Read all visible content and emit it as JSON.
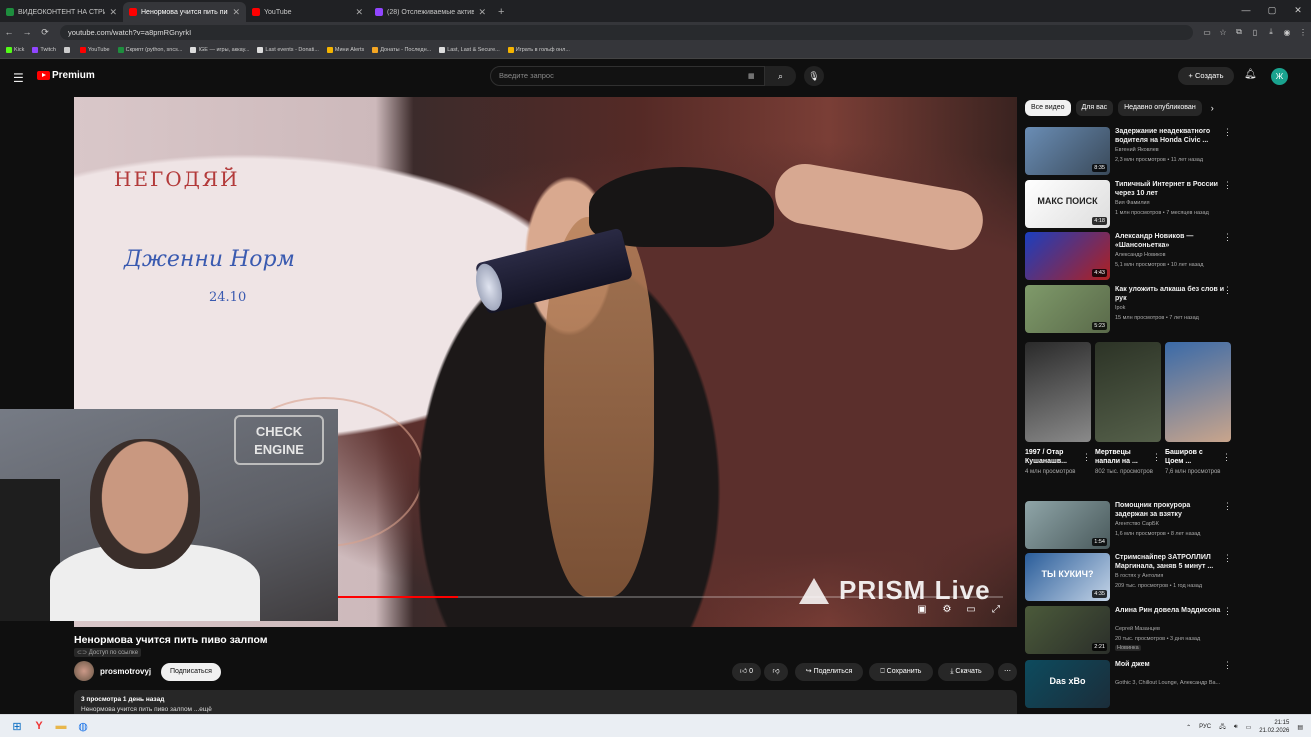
{
  "browser": {
    "tabs": [
      {
        "title": "ВИДЕОКОНТЕНТ НА СТРИМ N",
        "color": "#1e8e3e",
        "active": false
      },
      {
        "title": "Ненормова учится пить пиво",
        "color": "#ff0000",
        "active": true
      },
      {
        "title": "YouTube",
        "color": "#ff0000",
        "active": false
      },
      {
        "title": "(28) Отслеживаемые активн",
        "color": "#9146ff",
        "active": false
      }
    ],
    "new_tab": "+",
    "url": "youtube.com/watch?v=a8pmRGnyrkI",
    "bookmarks": [
      {
        "label": "Kick",
        "color": "#53fc18"
      },
      {
        "label": "Twitch",
        "color": "#9146ff"
      },
      {
        "label": "",
        "color": "#cccccc"
      },
      {
        "label": "YouTube",
        "color": "#ff0000"
      },
      {
        "label": "Скрипт (python, sncs...",
        "color": "#1e8e3e"
      },
      {
        "label": "IGE — игры, аккау...",
        "color": "#dddddd"
      },
      {
        "label": "Last events - Donati...",
        "color": "#dddddd"
      },
      {
        "label": "Мини Alerts",
        "color": "#f5b400"
      },
      {
        "label": "Донаты - Последн...",
        "color": "#f5a623"
      },
      {
        "label": "Last, Last & Secure...",
        "color": "#dddddd"
      },
      {
        "label": "Играть в гольф онл...",
        "color": "#f5b400"
      }
    ]
  },
  "youtube": {
    "logo": "Premium",
    "search_placeholder": "Введите запрос",
    "create_label": "Создать",
    "avatar_letter": "Ж"
  },
  "video": {
    "title": "Ненормова учится пить пиво залпом",
    "access_tag": "Доступ по ссылке",
    "channel": "prosmotrovyj",
    "subscribe": "Подписаться",
    "likes": "0",
    "share": "Поделиться",
    "save": "Сохранить",
    "download": "Скачать",
    "meta": "3 просмотра  1 день назад",
    "snippet": "Ненормова учится пить пиво залпом ...ещё",
    "overlay_brand": "PRISM Live",
    "pip_sign": "CHECK ENGINE",
    "board_text_1": "НЕГОДЯЙ",
    "board_text_2": "Дженни Норм",
    "board_text_3": "24.10",
    "progress": 0.18
  },
  "sidebar": {
    "chips": [
      "Все видео",
      "Для вас",
      "Недавно опубликован"
    ],
    "recs_top": [
      {
        "title": "Задержание неадекватного водителя на Honda Civic ...",
        "channel": "Евгений Яковлев",
        "meta": "2,3 млн просмотров • 11 лет назад",
        "duration": "8:35",
        "c1": "#6a8db5",
        "c2": "#3a4a5a"
      },
      {
        "title": "Типичный Интернет в России через 10 лет",
        "channel": "Вия Фамилия",
        "meta": "1 млн просмотров • 7 месяцев назад",
        "duration": "4:18",
        "c1": "#ffffff",
        "c2": "#dddddd",
        "thumb_text": "МАКС ПОИСК"
      },
      {
        "title": "Александр Новиков — «Шансоньетка»",
        "channel": "Александр Новиков",
        "meta": "5,1 млн просмотров • 10 лет назад",
        "duration": "4:43",
        "c1": "#1b3fbf",
        "c2": "#b02020"
      },
      {
        "title": "Как уложить алкаша без слов и рук",
        "channel": "Ipok",
        "meta": "15 млн просмотров • 7 лет назад",
        "duration": "5:23",
        "c1": "#7f9a6a",
        "c2": "#5a6a4a"
      }
    ],
    "shorts": [
      {
        "title": "1997 / Отар Кушанашв...",
        "views": "4 млн просмотров",
        "c1": "#2a2a2a",
        "c2": "#8a8a8a"
      },
      {
        "title": "Мертвецы напали на ...",
        "views": "802 тыс. просмотров",
        "c1": "#2c3326",
        "c2": "#55604a"
      },
      {
        "title": "Баширов с Цоем ...",
        "views": "7,6 млн просмотров",
        "c1": "#3a6aa8",
        "c2": "#c9a58c"
      }
    ],
    "recs_bottom": [
      {
        "title": "Помощник прокурора задержан за взятку",
        "channel": "Агентство СарБК",
        "meta": "1,6 млн просмотров • 8 лет назад",
        "duration": "1:54",
        "c1": "#8fa5a8",
        "c2": "#4a5a5c"
      },
      {
        "title": "Стримснайпер ЗАТРОЛЛИЛ Маргинала, заняв 5 минут ...",
        "channel": "В гостях у Антолия",
        "meta": "209 тыс. просмотров • 1 год назад",
        "duration": "4:35",
        "c1": "#2a5d9a",
        "c2": "#c3d3e6",
        "thumb_text": "ТЫ КУКИЧ?"
      },
      {
        "title": "Алина Рин довела Мэддисона",
        "channel": "Сергей Мазанцев",
        "meta": "20 тыс. просмотров • 3 дня назад",
        "duration": "2:21",
        "badge": "Новинка",
        "c1": "#4b5a3a",
        "c2": "#2b2f2a"
      },
      {
        "title": "Мой джем",
        "channel": "Gothic 3, Chillout Lounge, Александр Ва...",
        "meta": "",
        "duration": "",
        "c1": "#0d4b5e",
        "c2": "#1b2d3a",
        "thumb_text": "Das xBo"
      }
    ]
  },
  "taskbar": {
    "lang": "РУС",
    "time": "21:15",
    "date": "21.02.2026"
  }
}
